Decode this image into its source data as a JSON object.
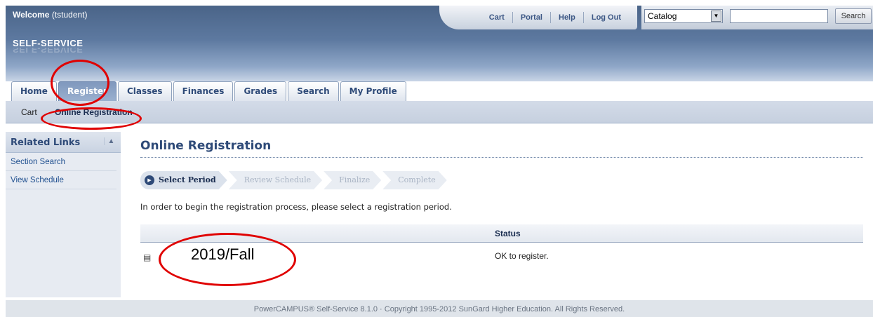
{
  "header": {
    "welcome_label": "Welcome",
    "welcome_user": "(tstudent)",
    "app_title": "SELF-SERVICE",
    "top_links": [
      "Cart",
      "Portal",
      "Help",
      "Log Out"
    ],
    "search": {
      "select_value": "Catalog",
      "input_value": "",
      "button_label": "Search"
    }
  },
  "tabs": [
    {
      "label": "Home",
      "active": false
    },
    {
      "label": "Register",
      "active": true
    },
    {
      "label": "Classes",
      "active": false
    },
    {
      "label": "Finances",
      "active": false
    },
    {
      "label": "Grades",
      "active": false
    },
    {
      "label": "Search",
      "active": false
    },
    {
      "label": "My Profile",
      "active": false
    }
  ],
  "subnav": {
    "items": [
      {
        "label": "Cart",
        "active": false
      },
      {
        "label": "Online Registration",
        "active": true
      }
    ]
  },
  "sidebar": {
    "title": "Related Links",
    "collapse_glyph": "▲",
    "links": [
      "Section Search",
      "View Schedule"
    ]
  },
  "main": {
    "title": "Online Registration",
    "steps": [
      "Select Period",
      "Review Schedule",
      "Finalize",
      "Complete"
    ],
    "instruction": "In order to begin the registration process, please select a registration period.",
    "table": {
      "status_header": "Status",
      "rows": [
        {
          "period": "2019/Fall",
          "status": "OK to register."
        }
      ]
    }
  },
  "footer": {
    "text": "PowerCAMPUS® Self-Service 8.1.0 · Copyright 1995-2012 SunGard Higher Education. All Rights Reserved."
  },
  "colors": {
    "annotation": "#e00000",
    "header": "#4a6488",
    "tab_active": "#7f98bd",
    "link": "#1f4f8f"
  }
}
